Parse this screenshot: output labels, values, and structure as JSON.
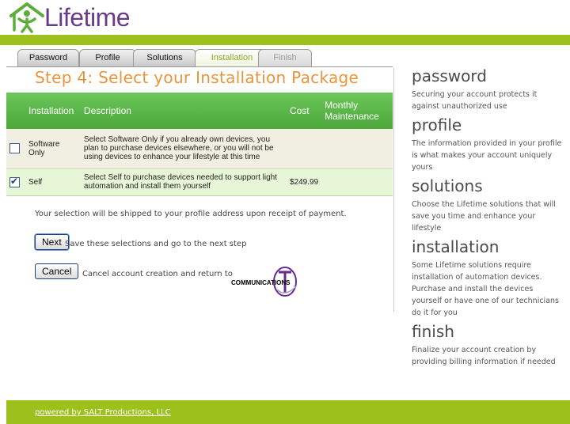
{
  "brand": {
    "name": "Lifetime"
  },
  "tabs": [
    {
      "label": "Password",
      "state": "normal"
    },
    {
      "label": "Profile",
      "state": "normal"
    },
    {
      "label": "Solutions",
      "state": "normal"
    },
    {
      "label": "Installation",
      "state": "active"
    },
    {
      "label": "Finish",
      "state": "disabled"
    }
  ],
  "step_title": "Step 4: Select your Installation Package",
  "table": {
    "headers": {
      "installation": "Installation",
      "description": "Description",
      "cost": "Cost",
      "maintenance_line1": "Monthly",
      "maintenance_line2": "Maintenance"
    },
    "rows": [
      {
        "installation_line1": "Software",
        "installation_line2": "Only",
        "description": "Select Software Only if you already own devices, you plan to purchase devices elsewhere, or you will not be using devices to enhance your lifestyle at this time",
        "cost": "",
        "maintenance": "",
        "checked": false
      },
      {
        "installation_line1": "Self",
        "installation_line2": "",
        "description": "Select Self to purchase devices needed to support light automation and install them yourself",
        "cost": "$249.99",
        "maintenance": "",
        "checked": true
      }
    ]
  },
  "ship_note": "Your selection will be shipped to your profile address upon receipt of payment.",
  "actions": {
    "next_label": "Next",
    "next_note": "Save these selections and go to the next step",
    "cancel_label": "Cancel",
    "cancel_note": "Cancel account creation and return to",
    "partner_logo_text": "COMMUNICATIONS"
  },
  "sidebar": [
    {
      "heading": "password",
      "text": "Securing your account protects it against unauthorized use"
    },
    {
      "heading": "profile",
      "text": "The information provided in your profile is what makes your account uniquely yours"
    },
    {
      "heading": "solutions",
      "text": "Choose the Lifetime solutions that will save you time and enhance your lifestyle"
    },
    {
      "heading": "installation",
      "text": "Some Lifetime solutions require installation of automation devices. Purchase and install the devices yourself or have one of our technicians do it for you"
    },
    {
      "heading": "finish",
      "text": "Finalize your account creation by providing billing information if needed"
    }
  ],
  "footer": {
    "link": "powered by SALT Productions, LLC"
  },
  "colors": {
    "brand_green": "#9cc11c",
    "table_header_green": "#5cb84a",
    "step_orange": "#e8953a",
    "logo_purple": "#6a3a8a"
  }
}
